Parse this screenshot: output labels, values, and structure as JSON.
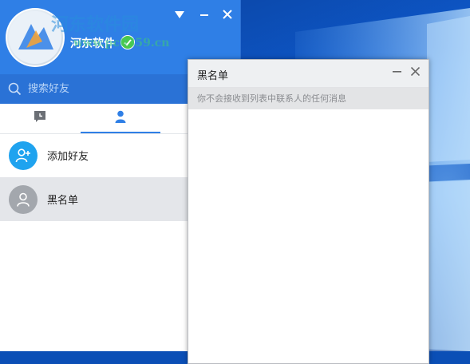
{
  "main_window": {
    "header": {
      "nickname": "河东软件",
      "watermark_title": "河东软件园",
      "watermark_url": "www.pc0359.cn",
      "accent_color": "#2f7fe6",
      "status_color": "#4cc84a"
    },
    "search": {
      "placeholder": "搜索好友"
    },
    "tabs": [
      {
        "name": "messages",
        "icon": "chat-bubble-icon",
        "active": false
      },
      {
        "name": "contacts",
        "icon": "person-icon",
        "active": true
      }
    ],
    "list": [
      {
        "label": "添加好友",
        "icon": "add-friend-icon",
        "color": "#1fa3ef"
      },
      {
        "label": "黑名单",
        "icon": "person-icon",
        "color": "#a3a7ad"
      }
    ]
  },
  "dialog": {
    "title": "黑名单",
    "hint": "你不会接收到列表中联系人的任何消息"
  }
}
